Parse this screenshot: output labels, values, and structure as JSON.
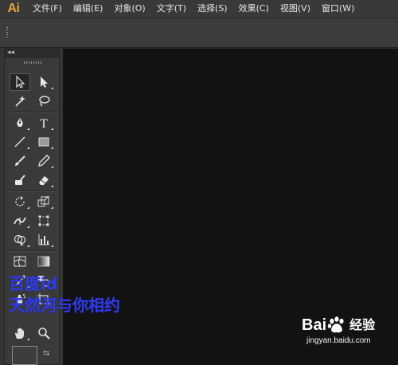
{
  "app": {
    "logo": "Ai"
  },
  "menu": {
    "items": [
      {
        "label": "文件(F)"
      },
      {
        "label": "编辑(E)"
      },
      {
        "label": "对象(O)"
      },
      {
        "label": "文字(T)"
      },
      {
        "label": "选择(S)"
      },
      {
        "label": "效果(C)"
      },
      {
        "label": "视图(V)"
      },
      {
        "label": "窗口(W)"
      }
    ]
  },
  "tools_panel": {
    "collapse_icon": "double-chevron-left-icon",
    "tools": [
      {
        "name": "selection-tool",
        "icon": "selection-arrow-icon",
        "selected": true
      },
      {
        "name": "direct-selection-tool",
        "icon": "direct-selection-arrow-icon"
      },
      {
        "name": "magic-wand-tool",
        "icon": "magic-wand-icon"
      },
      {
        "name": "lasso-tool",
        "icon": "lasso-icon"
      },
      {
        "name": "pen-tool",
        "icon": "pen-icon"
      },
      {
        "name": "type-tool",
        "icon": "type-icon",
        "glyph": "T"
      },
      {
        "name": "line-segment-tool",
        "icon": "line-icon"
      },
      {
        "name": "rectangle-tool",
        "icon": "rectangle-icon"
      },
      {
        "name": "paintbrush-tool",
        "icon": "paintbrush-icon"
      },
      {
        "name": "pencil-tool",
        "icon": "pencil-icon"
      },
      {
        "name": "blob-brush-tool",
        "icon": "blob-brush-icon"
      },
      {
        "name": "eraser-tool",
        "icon": "eraser-icon"
      },
      {
        "name": "rotate-tool",
        "icon": "rotate-icon"
      },
      {
        "name": "scale-tool",
        "icon": "scale-icon"
      },
      {
        "name": "width-tool",
        "icon": "width-icon"
      },
      {
        "name": "free-transform-tool",
        "icon": "free-transform-icon"
      },
      {
        "name": "shape-builder-tool",
        "icon": "shape-builder-icon"
      },
      {
        "name": "graph-tool",
        "icon": "column-graph-icon"
      },
      {
        "name": "mesh-tool",
        "icon": "mesh-icon"
      },
      {
        "name": "gradient-tool",
        "icon": "gradient-icon"
      },
      {
        "name": "eyedropper-tool",
        "icon": "eyedropper-icon"
      },
      {
        "name": "blend-tool",
        "icon": "blend-icon"
      },
      {
        "name": "symbol-sprayer-tool",
        "icon": "symbol-sprayer-icon"
      },
      {
        "name": "artboard-tool",
        "icon": "artboard-icon"
      },
      {
        "name": "hand-tool",
        "icon": "hand-icon"
      },
      {
        "name": "zoom-tool",
        "icon": "zoom-icon"
      }
    ],
    "swap_icon": "swap-colors-icon"
  },
  "overlay": {
    "line1": "百度id",
    "line2": "天然河与你相约",
    "color": "#2f3be0"
  },
  "watermark": {
    "brand_left": "Bai",
    "brand_right": "经验",
    "url": "jingyan.baidu.com",
    "paw_icon": "baidu-paw-icon"
  },
  "colors": {
    "logo": "#e8a33a",
    "canvas": "#121212",
    "chrome": "#393939"
  }
}
